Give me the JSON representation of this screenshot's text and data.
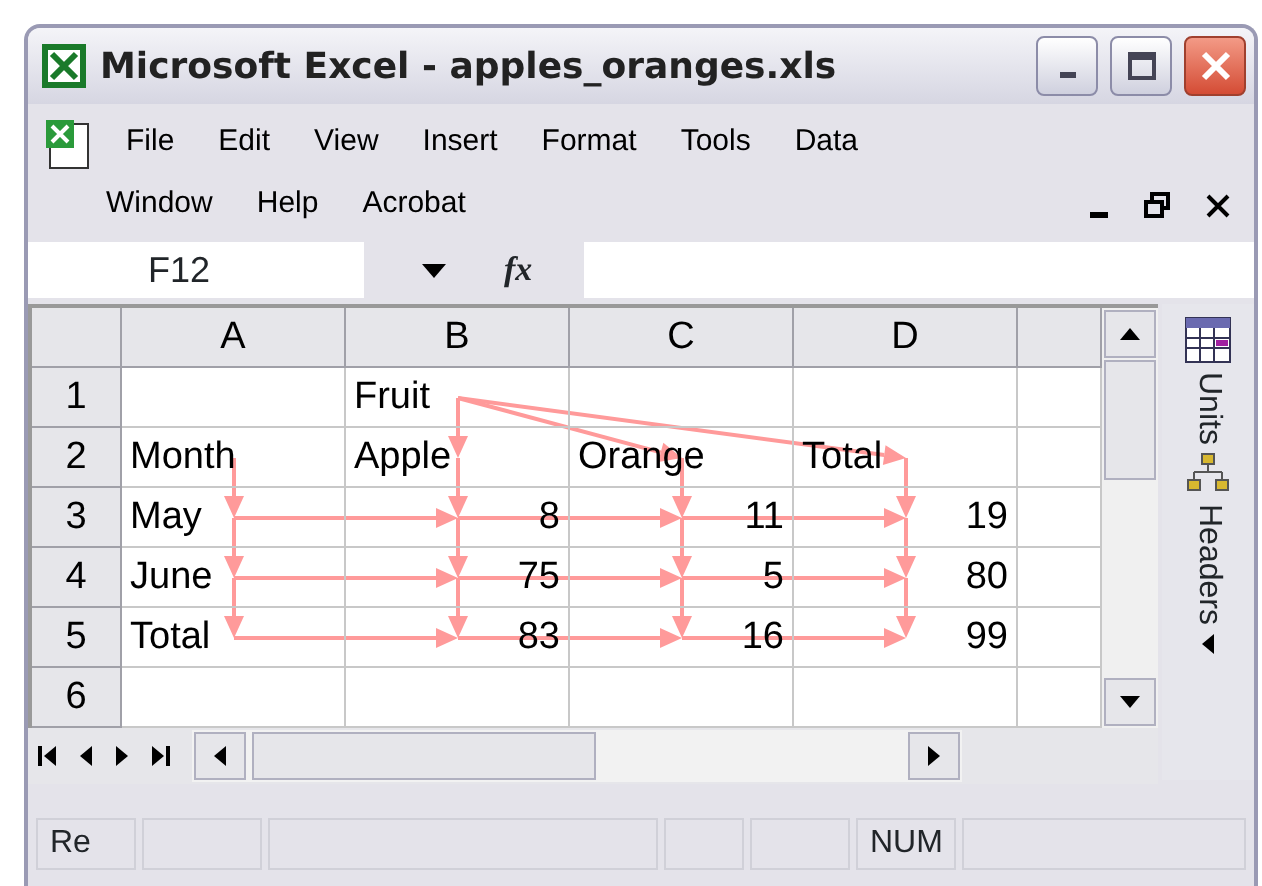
{
  "window": {
    "title": "Microsoft Excel - apples_oranges.xls"
  },
  "menu_rows": [
    [
      "File",
      "Edit",
      "View",
      "Insert",
      "Format",
      "Tools",
      "Data"
    ],
    [
      "Window",
      "Help",
      "Acrobat"
    ]
  ],
  "name_box": "F12",
  "function_label": "fx",
  "columns": [
    "A",
    "B",
    "C",
    "D"
  ],
  "rows": [
    {
      "header": "1",
      "cells": [
        null,
        {
          "text": "Fruit",
          "kind": "text",
          "arrow_fan": true
        },
        null,
        null
      ]
    },
    {
      "header": "2",
      "cells": [
        {
          "text": "Month",
          "kind": "text",
          "arrow_down": true
        },
        {
          "text": "Apple",
          "kind": "text",
          "arrow_down": true
        },
        {
          "text": "Orange",
          "kind": "text",
          "arrow_down": true
        },
        {
          "text": "Total",
          "kind": "text",
          "arrow_down": true
        }
      ]
    },
    {
      "header": "3",
      "cells": [
        {
          "text": "May",
          "kind": "text",
          "arrow_down": true,
          "arrow_right": true
        },
        {
          "text": "8",
          "kind": "number",
          "arrow_down": true,
          "arrow_right": true
        },
        {
          "text": "11",
          "kind": "number",
          "arrow_down": true,
          "arrow_right": true
        },
        {
          "text": "19",
          "kind": "number",
          "arrow_down": true
        }
      ]
    },
    {
      "header": "4",
      "cells": [
        {
          "text": "June",
          "kind": "text",
          "arrow_down": true,
          "arrow_right": true
        },
        {
          "text": "75",
          "kind": "number",
          "arrow_down": true,
          "arrow_right": true
        },
        {
          "text": "5",
          "kind": "number",
          "arrow_down": true,
          "arrow_right": true
        },
        {
          "text": "80",
          "kind": "number",
          "arrow_down": true
        }
      ]
    },
    {
      "header": "5",
      "cells": [
        {
          "text": "Total",
          "kind": "text",
          "arrow_right": true
        },
        {
          "text": "83",
          "kind": "number",
          "arrow_right": true
        },
        {
          "text": "16",
          "kind": "number",
          "arrow_right": true
        },
        {
          "text": "99",
          "kind": "number"
        }
      ]
    },
    {
      "header": "6",
      "cells": [
        null,
        null,
        null,
        null
      ]
    }
  ],
  "side_panel": [
    {
      "label": "Units",
      "kind": "calendar"
    },
    {
      "label": "Headers",
      "kind": "tree"
    }
  ],
  "status_bar": {
    "message": "Re",
    "indicator": "NUM"
  }
}
